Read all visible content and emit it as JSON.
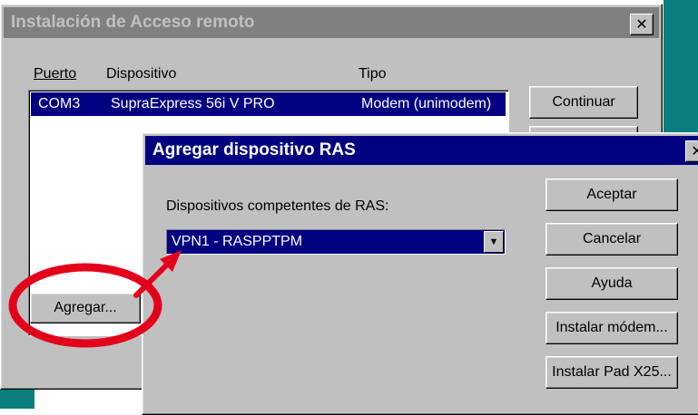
{
  "main_window": {
    "title": "Instalación de Acceso remoto",
    "columns": {
      "port": "Puerto",
      "device": "Dispositivo",
      "type": "Tipo"
    },
    "rows": [
      {
        "port": "COM3",
        "device": "SupraExpress 56i V PRO",
        "type": "Modem (unimodem)"
      }
    ],
    "buttons": {
      "continue": "Continuar",
      "add": "Agregar..."
    },
    "close_glyph": "✕"
  },
  "dialog": {
    "title": "Agregar dispositivo RAS",
    "label": "Dispositivos competentes de RAS:",
    "selected_device": "VPN1 - RASPPTPM",
    "buttons": {
      "accept": "Aceptar",
      "cancel": "Cancelar",
      "help": "Ayuda",
      "install_modem": "Instalar módem...",
      "install_pad": "Instalar Pad X25..."
    },
    "close_glyph": "✕"
  },
  "colors": {
    "title_active": "#000080",
    "title_inactive": "#808080",
    "desktop": "#0b7f7f",
    "annotation": "#e3001b"
  },
  "icons": [
    "close-icon",
    "dropdown-arrow-icon"
  ]
}
